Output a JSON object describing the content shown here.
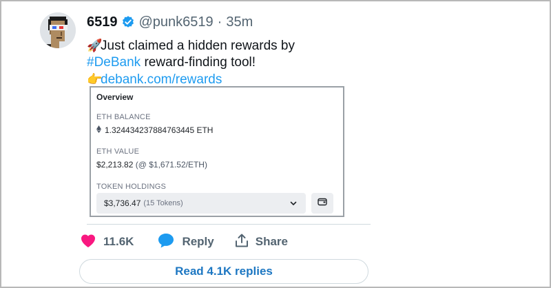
{
  "tweet": {
    "display_name": "6519",
    "handle": "@punk6519",
    "separator": "·",
    "time": "35m",
    "verified_icon": "verified-badge-icon",
    "avatar_icon": "cryptopunk-avatar",
    "text": {
      "line1_emoji": "🚀",
      "line1": "Just claimed a hidden rewards by",
      "hashtag": "#DeBank",
      "line2_rest": " reward-finding tool!",
      "line3_emoji": "👉",
      "link": "debank.com/rewards"
    }
  },
  "card": {
    "title": "Overview",
    "eth_balance_label": "ETH BALANCE",
    "eth_balance_value": "1.324434237884763445 ETH",
    "eth_value_label": "ETH VALUE",
    "eth_value_main": "$2,213.82",
    "eth_value_sub": "(@ $1,671.52/ETH)",
    "token_holdings_label": "TOKEN HOLDINGS",
    "token_holdings_amount": "$3,736.47",
    "token_holdings_count": "(15 Tokens)"
  },
  "actions": {
    "like_count": "11.6K",
    "reply_label": "Reply",
    "share_label": "Share"
  },
  "replies_button": "Read 4.1K replies",
  "colors": {
    "accent": "#1d9bf0",
    "like": "#f91880",
    "reply_bubble": "#1d9bf0",
    "replies_text": "#1d77c2"
  }
}
